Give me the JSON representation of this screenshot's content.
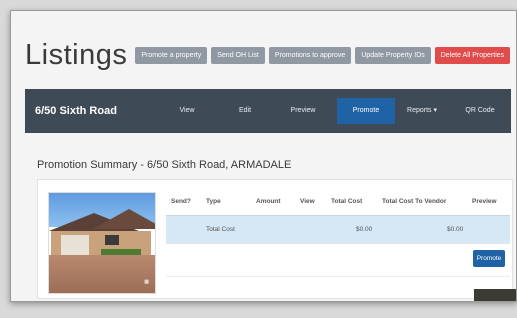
{
  "page": {
    "title": "Listings",
    "header_buttons": [
      {
        "label": "Promote a property",
        "style": "grey"
      },
      {
        "label": "Send OH List",
        "style": "grey"
      },
      {
        "label": "Promotions to approve",
        "style": "grey"
      },
      {
        "label": "Update Property IDs",
        "style": "grey"
      },
      {
        "label": "Delete All Properties",
        "style": "red"
      }
    ]
  },
  "navbar": {
    "property": "6/50 Sixth Road",
    "items": [
      {
        "label": "View"
      },
      {
        "label": "Edit"
      },
      {
        "label": "Preview"
      },
      {
        "label": "Promote",
        "active": true
      },
      {
        "label": "Reports ▾"
      },
      {
        "label": "QR Code"
      }
    ]
  },
  "summary": {
    "title": "Promotion Summary - 6/50 Sixth Road, ARMADALE",
    "columns": [
      "Send?",
      "Type",
      "Amount",
      "View",
      "Total Cost",
      "Total Cost To Vendor",
      "Preview"
    ],
    "rows": [
      {
        "send": "",
        "type": "Total Cost",
        "amount": "",
        "view": "",
        "total_cost": "$0.00",
        "total_cost_to_vendor": "$0.00",
        "preview": ""
      }
    ],
    "promote_button": "Promote"
  },
  "colors": {
    "navbar": "#3f4a57",
    "primary": "#1f62a6",
    "danger": "#e04b4b",
    "secondary": "#8f98a3",
    "highlight_row": "#d6e8f5"
  }
}
